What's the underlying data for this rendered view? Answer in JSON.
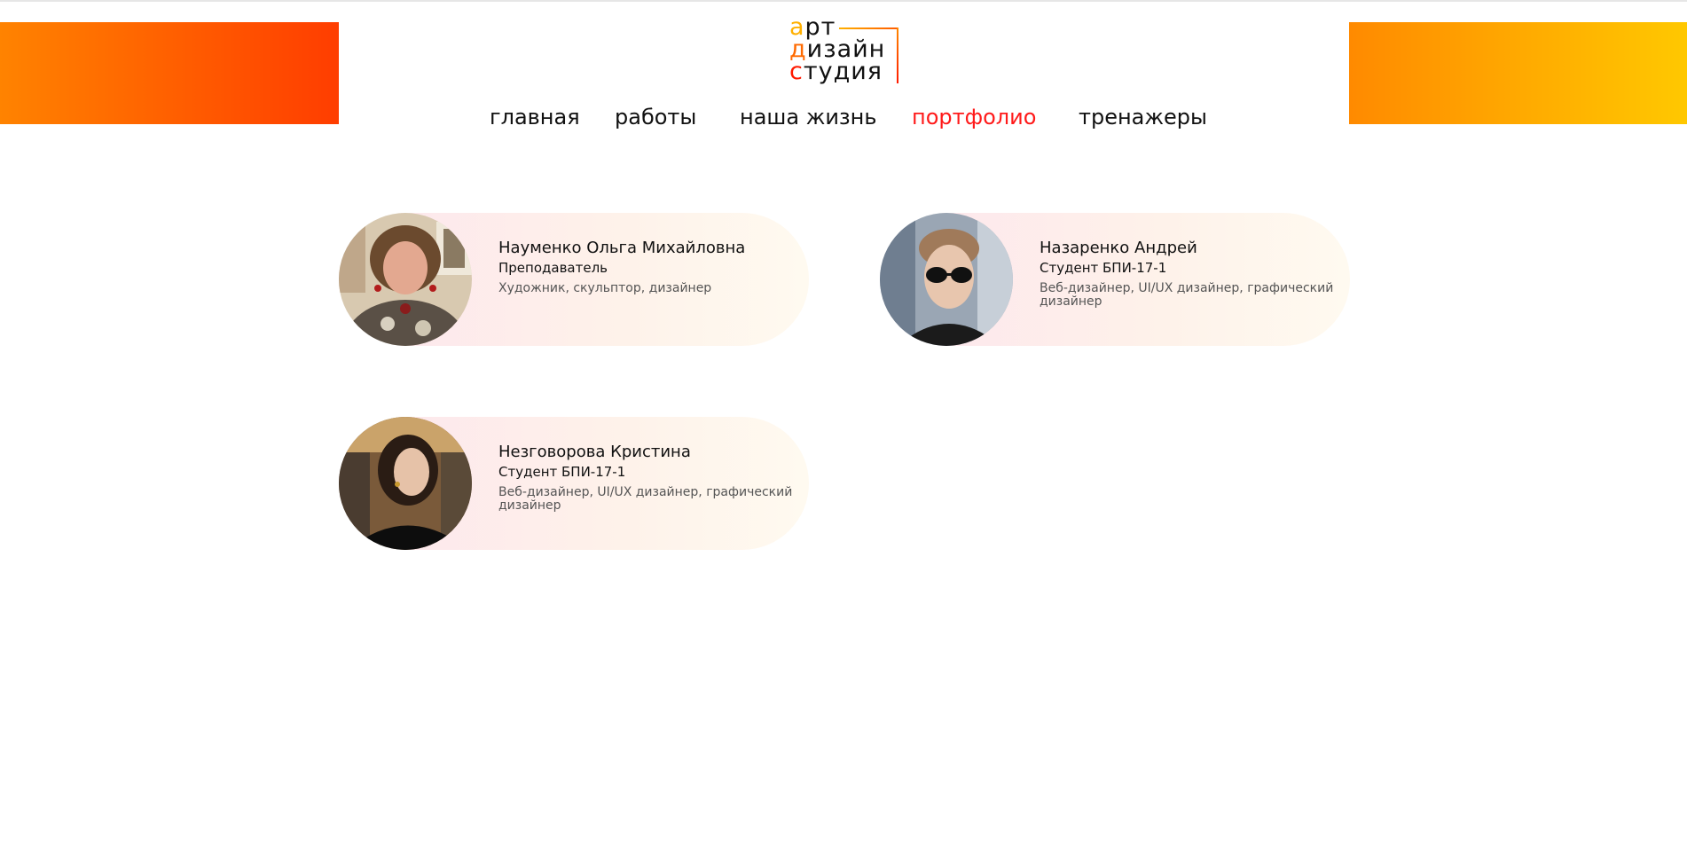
{
  "logo": {
    "line1_first": "а",
    "line1_rest": "рт",
    "line2_first": "д",
    "line2_rest": "изайн",
    "line3_first": "с",
    "line3_rest": "тудия"
  },
  "nav": {
    "items": [
      {
        "label": "главная",
        "active": false
      },
      {
        "label": "работы",
        "active": false
      },
      {
        "label": "наша жизнь",
        "active": false
      },
      {
        "label": "портфолио",
        "active": true
      },
      {
        "label": "тренажеры",
        "active": false
      }
    ],
    "active_color": "#ff1a1a"
  },
  "colors": {
    "band_left": [
      "#ff8300",
      "#ff3d00"
    ],
    "band_right": [
      "#ff8a00",
      "#ffc800"
    ],
    "card_gradient": [
      "#fde8ec",
      "#fffaf0"
    ]
  },
  "people": [
    {
      "name": "Науменко Ольга Михайловна",
      "role": "Преподаватель",
      "description": "Художник, скульптор, дизайнер",
      "avatar": "photo-woman-curly-hair"
    },
    {
      "name": "Назаренко Андрей",
      "role": "Студент БПИ-17-1",
      "description": "Веб-дизайнер, UI/UX дизайнер, графический дизайнер",
      "avatar": "photo-young-man-sunglasses"
    },
    {
      "name": "Незговорова Кристина",
      "role": "Студент БПИ-17-1",
      "description": "Веб-дизайнер, UI/UX дизайнер, графический дизайнер",
      "avatar": "photo-young-woman-dark-hair"
    }
  ]
}
